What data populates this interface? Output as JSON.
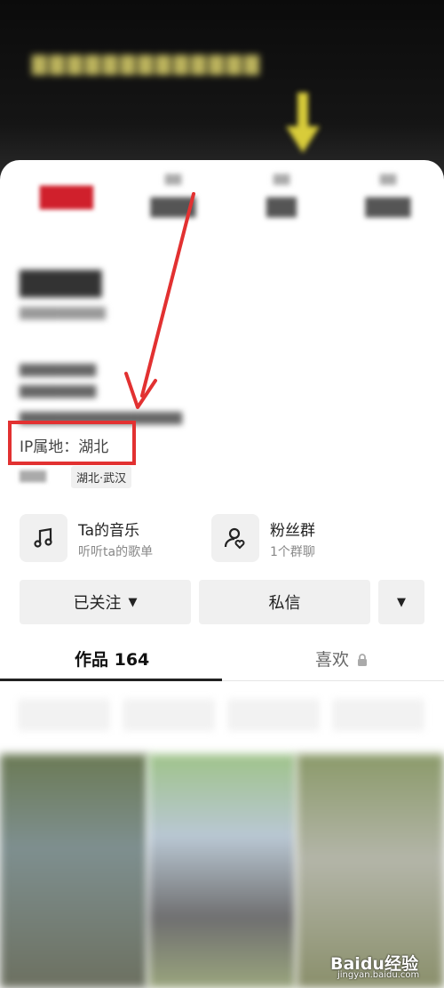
{
  "profile": {
    "ip_label": "IP属地：湖北",
    "city_tag": "湖北·武汉"
  },
  "features": {
    "music": {
      "title": "Ta的音乐",
      "subtitle": "听听ta的歌单",
      "icon": "music-note-icon"
    },
    "fans": {
      "title": "粉丝群",
      "subtitle": "1个群聊",
      "icon": "fan-group-icon"
    }
  },
  "actions": {
    "follow_label": "已关注",
    "message_label": "私信"
  },
  "tabs": {
    "works_label": "作品 164",
    "likes_label": "喜欢"
  },
  "watermark": {
    "brand": "Baidu经验",
    "domain": "jingyan.baidu.com"
  },
  "colors": {
    "highlight": "#e23131",
    "banner_text": "#d9cf6a"
  }
}
